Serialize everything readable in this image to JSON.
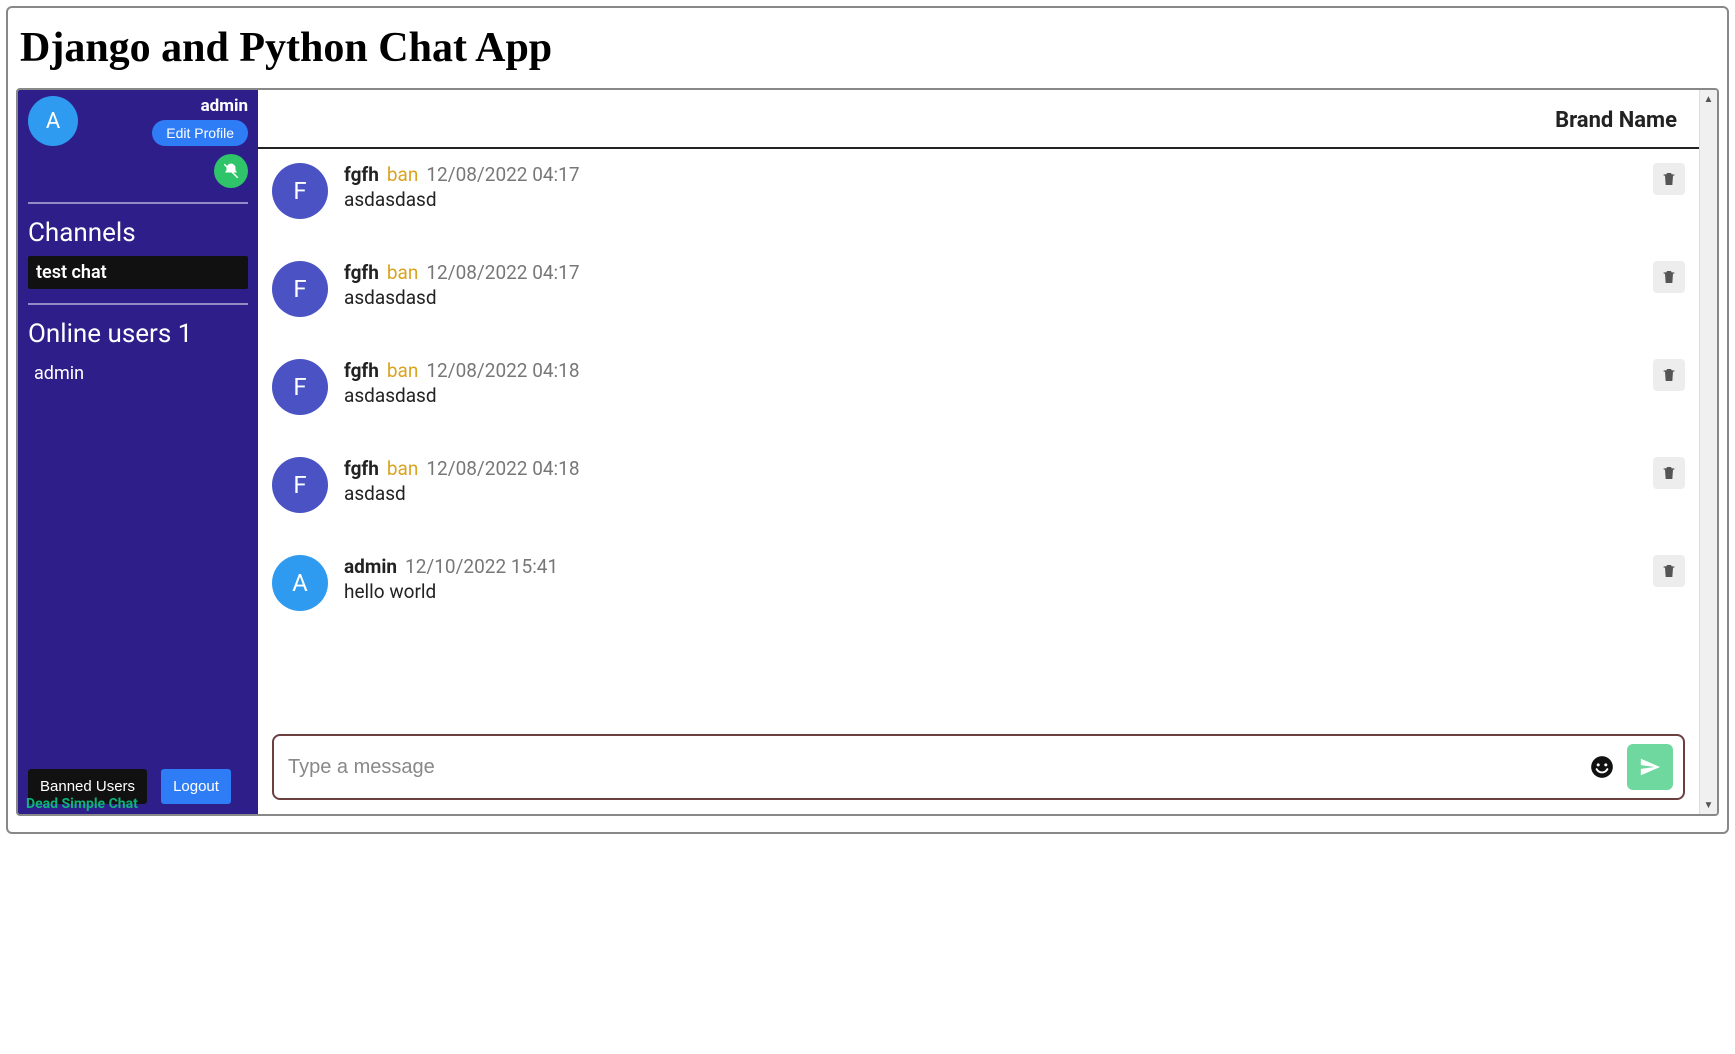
{
  "page": {
    "title": "Django and Python Chat App"
  },
  "sidebar": {
    "user": {
      "name": "admin",
      "initial": "A"
    },
    "edit_profile_label": "Edit Profile",
    "channels_heading": "Channels",
    "channels": [
      {
        "name": "test chat"
      }
    ],
    "online_heading": "Online users 1",
    "online_users": [
      {
        "name": "admin"
      }
    ],
    "banned_users_label": "Banned Users",
    "logout_label": "Logout"
  },
  "header": {
    "brand": "Brand Name"
  },
  "messages": [
    {
      "user": "fgfh",
      "ban_label": "ban",
      "time": "12/08/2022 04:17",
      "text": "asdasdasd",
      "initial": "F",
      "avatar_class": "avatar-fgfh"
    },
    {
      "user": "fgfh",
      "ban_label": "ban",
      "time": "12/08/2022 04:17",
      "text": "asdasdasd",
      "initial": "F",
      "avatar_class": "avatar-fgfh"
    },
    {
      "user": "fgfh",
      "ban_label": "ban",
      "time": "12/08/2022 04:18",
      "text": "asdasdasd",
      "initial": "F",
      "avatar_class": "avatar-fgfh"
    },
    {
      "user": "fgfh",
      "ban_label": "ban",
      "time": "12/08/2022 04:18",
      "text": "asdasd",
      "initial": "F",
      "avatar_class": "avatar-fgfh"
    },
    {
      "user": "admin",
      "ban_label": "",
      "time": "12/10/2022 15:41",
      "text": "hello world",
      "initial": "A",
      "avatar_class": "avatar-admin"
    }
  ],
  "composer": {
    "placeholder": "Type a message"
  },
  "footer": {
    "link_text": "Dead Simple Chat"
  }
}
